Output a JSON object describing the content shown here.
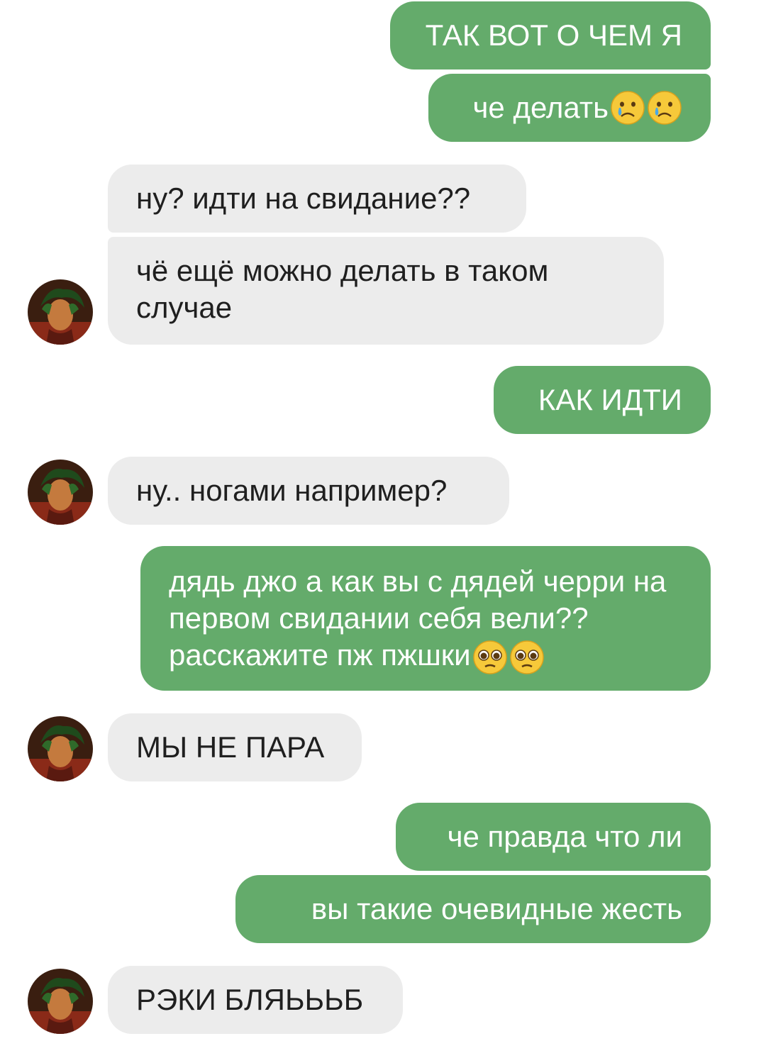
{
  "messages": [
    {
      "side": "out",
      "text": "ТАК ВОТ О ЧЕМ Я"
    },
    {
      "side": "out",
      "text": "че делать",
      "emoji": [
        "crying-face-icon",
        "crying-face-icon"
      ]
    },
    {
      "side": "in",
      "text": "ну? идти на свидание??"
    },
    {
      "side": "in",
      "text": "чё ещё можно делать в таком случае"
    },
    {
      "side": "out",
      "text": "КАК ИДТИ"
    },
    {
      "side": "in",
      "text": "ну.. ногами например?"
    },
    {
      "side": "out",
      "text": "дядь джо а как вы с дядей черри на первом свидании себя вели?? расскажите пж пжшки",
      "emoji": [
        "pleading-face-icon",
        "pleading-face-icon"
      ]
    },
    {
      "side": "in",
      "text": "МЫ НЕ ПАРА"
    },
    {
      "side": "out",
      "text": "че правда что ли"
    },
    {
      "side": "out",
      "text": "вы такие очевидные жесть"
    },
    {
      "side": "in",
      "text": "РЭКИ БЛЯЬЬЬБ"
    }
  ],
  "colors": {
    "outgoing_bubble": "#64ab6b",
    "incoming_bubble": "#ececec",
    "outgoing_text": "#ffffff",
    "incoming_text": "#1f1f1f"
  }
}
